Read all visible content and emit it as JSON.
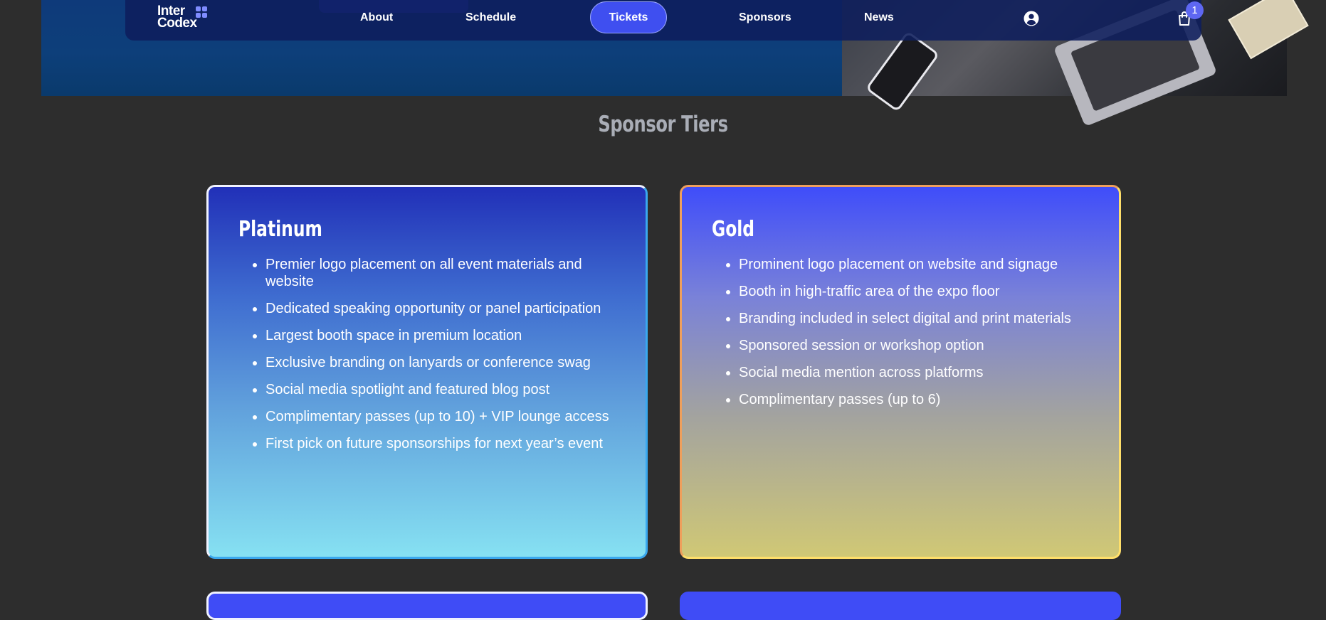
{
  "brand": {
    "line1": "Inter",
    "line2": "Codex"
  },
  "nav": {
    "about": "About",
    "schedule": "Schedule",
    "tickets": "Tickets",
    "sponsors": "Sponsors",
    "news": "News",
    "cart_count": "1",
    "active": "Tickets"
  },
  "icons": {
    "account": "user-circle-icon",
    "cart": "shopping-bag-icon",
    "logo": "four-squares-logo-icon"
  },
  "colors": {
    "page_bg": "#2d2d2d",
    "accent": "#3f4ff0",
    "title": "#a9adb6"
  },
  "section": {
    "title": "Sponsor Tiers"
  },
  "tiers": [
    {
      "name": "Platinum",
      "benefits": [
        "Premier logo placement on all event materials and website",
        "Dedicated speaking opportunity or panel participation",
        "Largest booth space in premium location",
        "Exclusive branding on lanyards or conference swag",
        "Social media spotlight and featured blog post",
        "Complimentary passes (up to 10) + VIP lounge access",
        "First pick on future sponsorships for next year’s event"
      ]
    },
    {
      "name": "Gold",
      "benefits": [
        "Prominent logo placement on website and signage",
        "Booth in high-traffic area of the expo floor",
        "Branding included in select digital and print materials",
        "Sponsored session or workshop option",
        "Social media mention across platforms",
        "Complimentary passes (up to 6)"
      ]
    }
  ]
}
